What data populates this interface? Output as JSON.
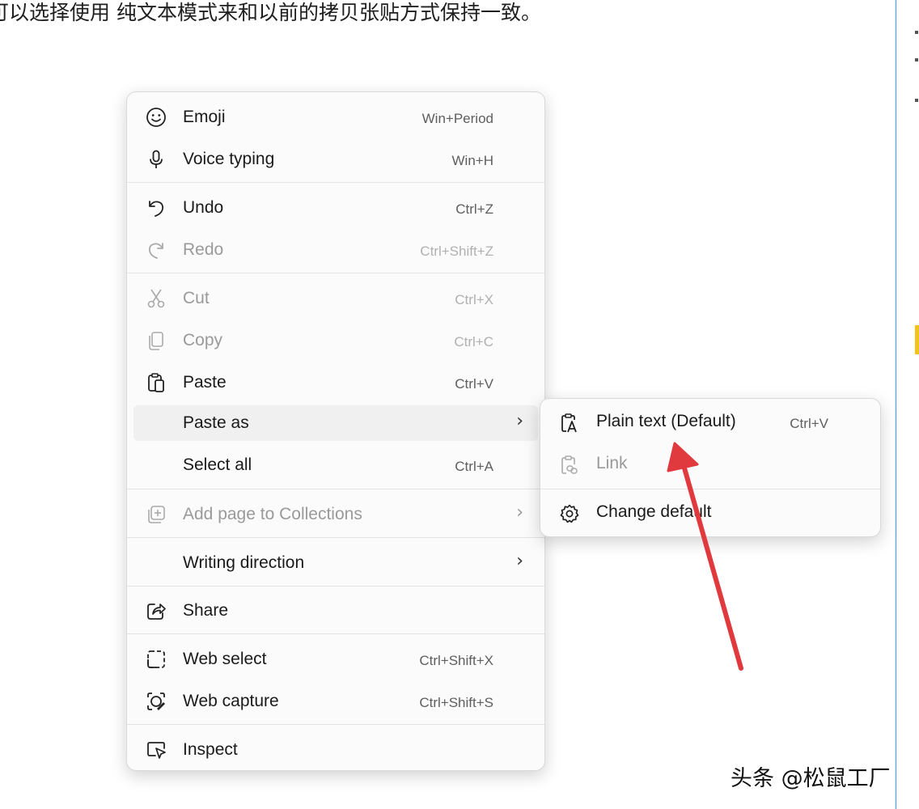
{
  "background": {
    "text": "可以选择使用 纯文本模式来和以前的拷贝张贴方式保持一致。"
  },
  "context_menu": {
    "items": [
      {
        "label": "Emoji",
        "shortcut": "Win+Period",
        "icon": "emoji-icon",
        "disabled": false
      },
      {
        "label": "Voice typing",
        "shortcut": "Win+H",
        "icon": "microphone-icon",
        "disabled": false
      },
      {
        "label": "Undo",
        "shortcut": "Ctrl+Z",
        "icon": "undo-icon",
        "disabled": false
      },
      {
        "label": "Redo",
        "shortcut": "Ctrl+Shift+Z",
        "icon": "redo-icon",
        "disabled": true
      },
      {
        "label": "Cut",
        "shortcut": "Ctrl+X",
        "icon": "scissors-icon",
        "disabled": true
      },
      {
        "label": "Copy",
        "shortcut": "Ctrl+C",
        "icon": "copy-icon",
        "disabled": true
      },
      {
        "label": "Paste",
        "shortcut": "Ctrl+V",
        "icon": "paste-icon",
        "disabled": false
      },
      {
        "label": "Paste as",
        "shortcut": "",
        "icon": "",
        "disabled": false,
        "submenu": true,
        "highlighted": true
      },
      {
        "label": "Select all",
        "shortcut": "Ctrl+A",
        "icon": "",
        "disabled": false
      },
      {
        "label": "Add page to Collections",
        "shortcut": "",
        "icon": "collections-icon",
        "disabled": true,
        "submenu": true
      },
      {
        "label": "Writing direction",
        "shortcut": "",
        "icon": "",
        "disabled": false,
        "submenu": true
      },
      {
        "label": "Share",
        "shortcut": "",
        "icon": "share-icon",
        "disabled": false
      },
      {
        "label": "Web select",
        "shortcut": "Ctrl+Shift+X",
        "icon": "web-select-icon",
        "disabled": false
      },
      {
        "label": "Web capture",
        "shortcut": "Ctrl+Shift+S",
        "icon": "web-capture-icon",
        "disabled": false
      },
      {
        "label": "Inspect",
        "shortcut": "",
        "icon": "inspect-icon",
        "disabled": false
      }
    ]
  },
  "submenu": {
    "items": [
      {
        "label": "Plain text (Default)",
        "shortcut": "Ctrl+V",
        "icon": "plain-text-paste-icon",
        "disabled": false
      },
      {
        "label": "Link",
        "shortcut": "",
        "icon": "link-paste-icon",
        "disabled": true
      },
      {
        "label": "Change default",
        "shortcut": "",
        "icon": "gear-icon",
        "disabled": false
      }
    ]
  },
  "watermark": {
    "text": "头条 @松鼠工厂"
  },
  "colors": {
    "annotation_arrow": "#e0393e",
    "menu_background": "#fbfbfb",
    "hover_background": "#f0f0f0"
  }
}
